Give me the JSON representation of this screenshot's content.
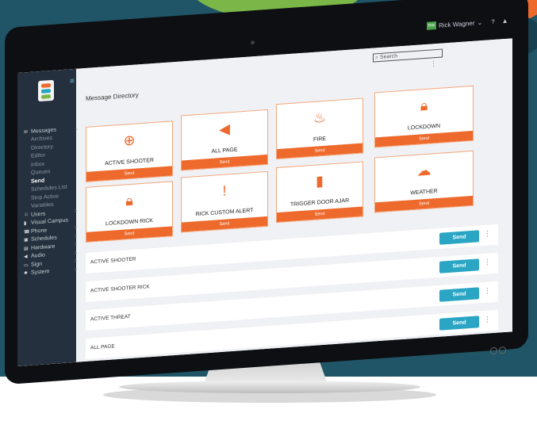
{
  "app": {
    "title": "Message Directory"
  },
  "header": {
    "search_placeholder": "Search",
    "user_initials": "RW",
    "user_name": "Rick Wagner",
    "user_chevron": "⌄",
    "help_icon": "help-icon",
    "bell_icon": "bell-icon"
  },
  "sidebar": {
    "items": [
      {
        "label": "Messages",
        "icon": "envelope-icon",
        "chev": "⌄"
      },
      {
        "label": "Archives"
      },
      {
        "label": "Directory"
      },
      {
        "label": "Editor"
      },
      {
        "label": "Inbox"
      },
      {
        "label": "Queues"
      },
      {
        "label": "Send"
      },
      {
        "label": "Schedules List"
      },
      {
        "label": "Stop Active"
      },
      {
        "label": "Variables"
      },
      {
        "label": "Users",
        "icon": "user-icon",
        "chev": ">"
      },
      {
        "label": "Visual Campus",
        "icon": "map-icon"
      },
      {
        "label": "Phone",
        "icon": "phone-icon",
        "chev": ">"
      },
      {
        "label": "Schedules",
        "icon": "calendar-icon",
        "chev": ">"
      },
      {
        "label": "Hardware",
        "icon": "hardware-icon",
        "chev": ">"
      },
      {
        "label": "Audio",
        "icon": "speaker-icon",
        "chev": ">"
      },
      {
        "label": "Sign",
        "icon": "monitor-icon",
        "chev": ">"
      },
      {
        "label": "System",
        "icon": "gear-icon",
        "chev": ">"
      }
    ]
  },
  "cards": [
    {
      "label": "ACTIVE SHOOTER",
      "icon": "crosshair-icon",
      "send": "Send"
    },
    {
      "label": "ALL PAGE",
      "icon": "megaphone-icon",
      "send": "Send"
    },
    {
      "label": "FIRE",
      "icon": "fire-icon",
      "send": "Send"
    },
    {
      "label": "LOCKDOWN",
      "icon": "lock-icon",
      "send": "Send"
    },
    {
      "label": "LOCKDOWN RICK",
      "icon": "lock-icon",
      "send": "Send"
    },
    {
      "label": "RICK CUSTOM ALERT",
      "icon": "exclamation-icon",
      "send": "Send"
    },
    {
      "label": "TRIGGER DOOR AJAR",
      "icon": "door-icon",
      "send": "Send"
    },
    {
      "label": "WEATHER",
      "icon": "cloud-icon",
      "send": "Send"
    }
  ],
  "list": [
    {
      "name": "ACTIVE SHOOTER",
      "send": "Send"
    },
    {
      "name": "ACTIVE SHOOTER RICK",
      "send": "Send"
    },
    {
      "name": "ACTIVE THREAT",
      "send": "Send"
    },
    {
      "name": "ALL PAGE",
      "send": "Send"
    }
  ],
  "colors": {
    "accent": "#ee6a2c",
    "button": "#2aa5c4",
    "sidebar": "#24303d",
    "background": "#1f5566"
  }
}
